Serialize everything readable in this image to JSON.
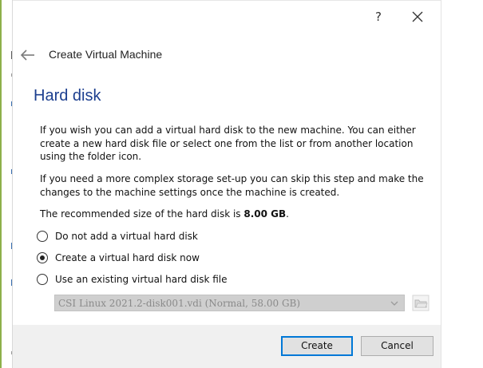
{
  "window": {
    "help_label": "?",
    "close_icon": "close-icon"
  },
  "header": {
    "back_icon": "back-arrow-icon",
    "title": "Create Virtual Machine"
  },
  "page": {
    "heading": "Hard disk",
    "paragraph1": "If you wish you can add a virtual hard disk to the new machine. You can either create a new hard disk file or select one from the list or from another location using the folder icon.",
    "paragraph2": "If you need a more complex storage set-up you can skip this step and make the changes to the machine settings once the machine is created.",
    "recommended_prefix": "The recommended size of the hard disk is ",
    "recommended_size": "8.00 GB",
    "recommended_suffix": "."
  },
  "options": [
    {
      "label": "Do not add a virtual hard disk",
      "checked": false
    },
    {
      "label": "Create a virtual hard disk now",
      "checked": true
    },
    {
      "label": "Use an existing virtual hard disk file",
      "checked": false
    }
  ],
  "disk_selector": {
    "selected_value": "CSI Linux 2021.2-disk001.vdi (Normal, 58.00 GB)",
    "enabled": false,
    "folder_icon": "folder-icon"
  },
  "buttons": {
    "create_label": "Create",
    "cancel_label": "Cancel"
  },
  "colors": {
    "heading": "#1d3f8f",
    "accent_border": "#0078d7",
    "footer_bg": "#f0f0f0"
  }
}
